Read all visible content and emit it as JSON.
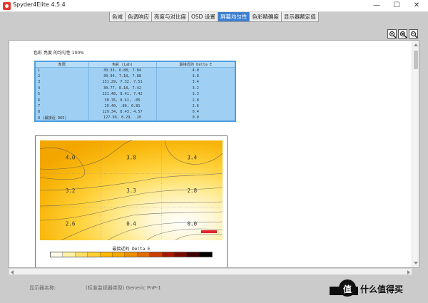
{
  "window": {
    "title": "Spyder4Elite 4.5.4",
    "min_glyph": "—",
    "max_glyph": "☐",
    "close_glyph": "✕"
  },
  "tabs": [
    {
      "label": "色域"
    },
    {
      "label": "色调响应"
    },
    {
      "label": "亮度与对比度"
    },
    {
      "label": "OSD 设置"
    },
    {
      "label": "屏幕均匀性",
      "active": true
    },
    {
      "label": "色彩精确度"
    },
    {
      "label": "显示器额定值"
    }
  ],
  "zoom": {
    "icons": [
      "zoom-in-icon",
      "zoom-fit-icon",
      "zoom-out-icon"
    ]
  },
  "report": {
    "title": "色彩 亮度 的均匀性 100%",
    "table": {
      "headers": [
        "象限",
        "色彩 (Lab)",
        "最接近的 Delta E"
      ],
      "rows": [
        {
          "zone": "1",
          "lab": "30.33, 6.88, 7.84",
          "de": "4.0"
        },
        {
          "zone": "2",
          "lab": "30.94, 7.18, 7.88",
          "de": "3.8"
        },
        {
          "zone": "3",
          "lab": "131.29, 7.32, 7.51",
          "de": "3.4"
        },
        {
          "zone": "4",
          "lab": "30.77, 8.18, 7.42",
          "de": "3.2"
        },
        {
          "zone": "5",
          "lab": "131.48, 8.41, 7.42",
          "de": "3.3"
        },
        {
          "zone": "6",
          "lab": "30.76, 8.41, .05",
          "de": "2.8"
        },
        {
          "zone": "7",
          "lab": "29.40, .80, 6.81",
          "de": "2.6"
        },
        {
          "zone": "8",
          "lab": "129.34, 8.43, 4.57",
          "de": "0.4"
        },
        {
          "zone": "9 (最接近 D65)",
          "lab": "127.99, 8.29, .20",
          "de": "0.0"
        }
      ]
    },
    "chart_caption": "最接近的 Delta E"
  },
  "chart_data": {
    "type": "heatmap",
    "title": "",
    "caption": "最接近的 Delta E",
    "grid": {
      "rows": 3,
      "cols": 3
    },
    "cells": [
      {
        "zone": 1,
        "row": 0,
        "col": 0,
        "value": 4.0,
        "label": "4.0"
      },
      {
        "zone": 2,
        "row": 0,
        "col": 1,
        "value": 3.8,
        "label": "3.8"
      },
      {
        "zone": 3,
        "row": 0,
        "col": 2,
        "value": 3.4,
        "label": "3.4"
      },
      {
        "zone": 4,
        "row": 1,
        "col": 0,
        "value": 3.2,
        "label": "3.2"
      },
      {
        "zone": 5,
        "row": 1,
        "col": 1,
        "value": 3.3,
        "label": "3.3"
      },
      {
        "zone": 6,
        "row": 1,
        "col": 2,
        "value": 2.8,
        "label": "2.8"
      },
      {
        "zone": 7,
        "row": 2,
        "col": 0,
        "value": 2.6,
        "label": "2.6"
      },
      {
        "zone": 8,
        "row": 2,
        "col": 1,
        "value": 0.4,
        "label": "0.4"
      },
      {
        "zone": 9,
        "row": 2,
        "col": 2,
        "value": 0.0,
        "label": "0.0"
      }
    ],
    "colorscale": [
      "#fffbe8",
      "#fff2a6",
      "#ffe066",
      "#ffcf33",
      "#ffb700",
      "#f7a800",
      "#ee8f00",
      "#e06c00",
      "#cc3d00",
      "#a81800",
      "#7a0a00",
      "#3d0000",
      "#000000"
    ]
  },
  "footer": {
    "label": "显示器名称:",
    "value": "(标准监视器类型) Generic PnP-1"
  },
  "watermark": {
    "logo_glyph": "值",
    "text": "什么值得买"
  },
  "colors": {
    "tab_active": "#3b7fd1",
    "table_bg": "#9fd0f4",
    "marker": "#e0232f"
  }
}
